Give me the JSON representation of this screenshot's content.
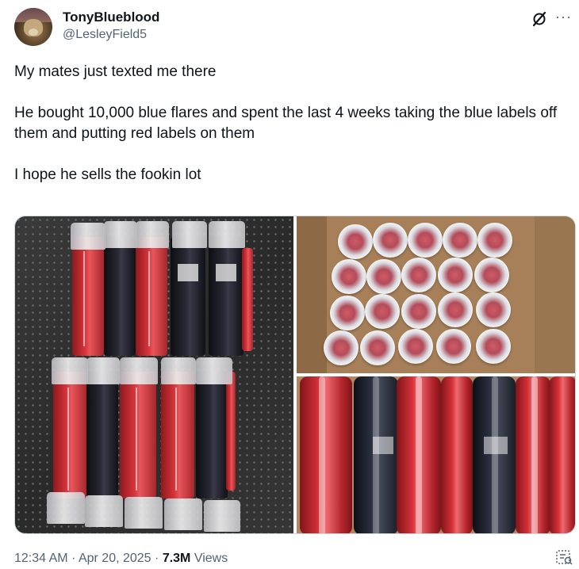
{
  "author": {
    "display_name": "TonyBlueblood",
    "handle": "@LesleyField5"
  },
  "icons": {
    "grok": "grok-icon",
    "more": "more-icon",
    "analytics": "analytics-icon",
    "more_glyph": "···"
  },
  "tweet": {
    "lines": [
      "My mates just texted me there",
      "He bought 10,000 blue flares and spent the last 4 weeks taking the blue labels off them and putting red labels on them",
      "I hope he sells the fookin lot"
    ]
  },
  "meta": {
    "time": "12:34 AM",
    "separator": "·",
    "date": "Apr 20, 2025",
    "views_count": "7.3M",
    "views_label": "Views"
  },
  "colors": {
    "text": "#0f1419",
    "secondary": "#536471",
    "border": "#cfd9de"
  }
}
